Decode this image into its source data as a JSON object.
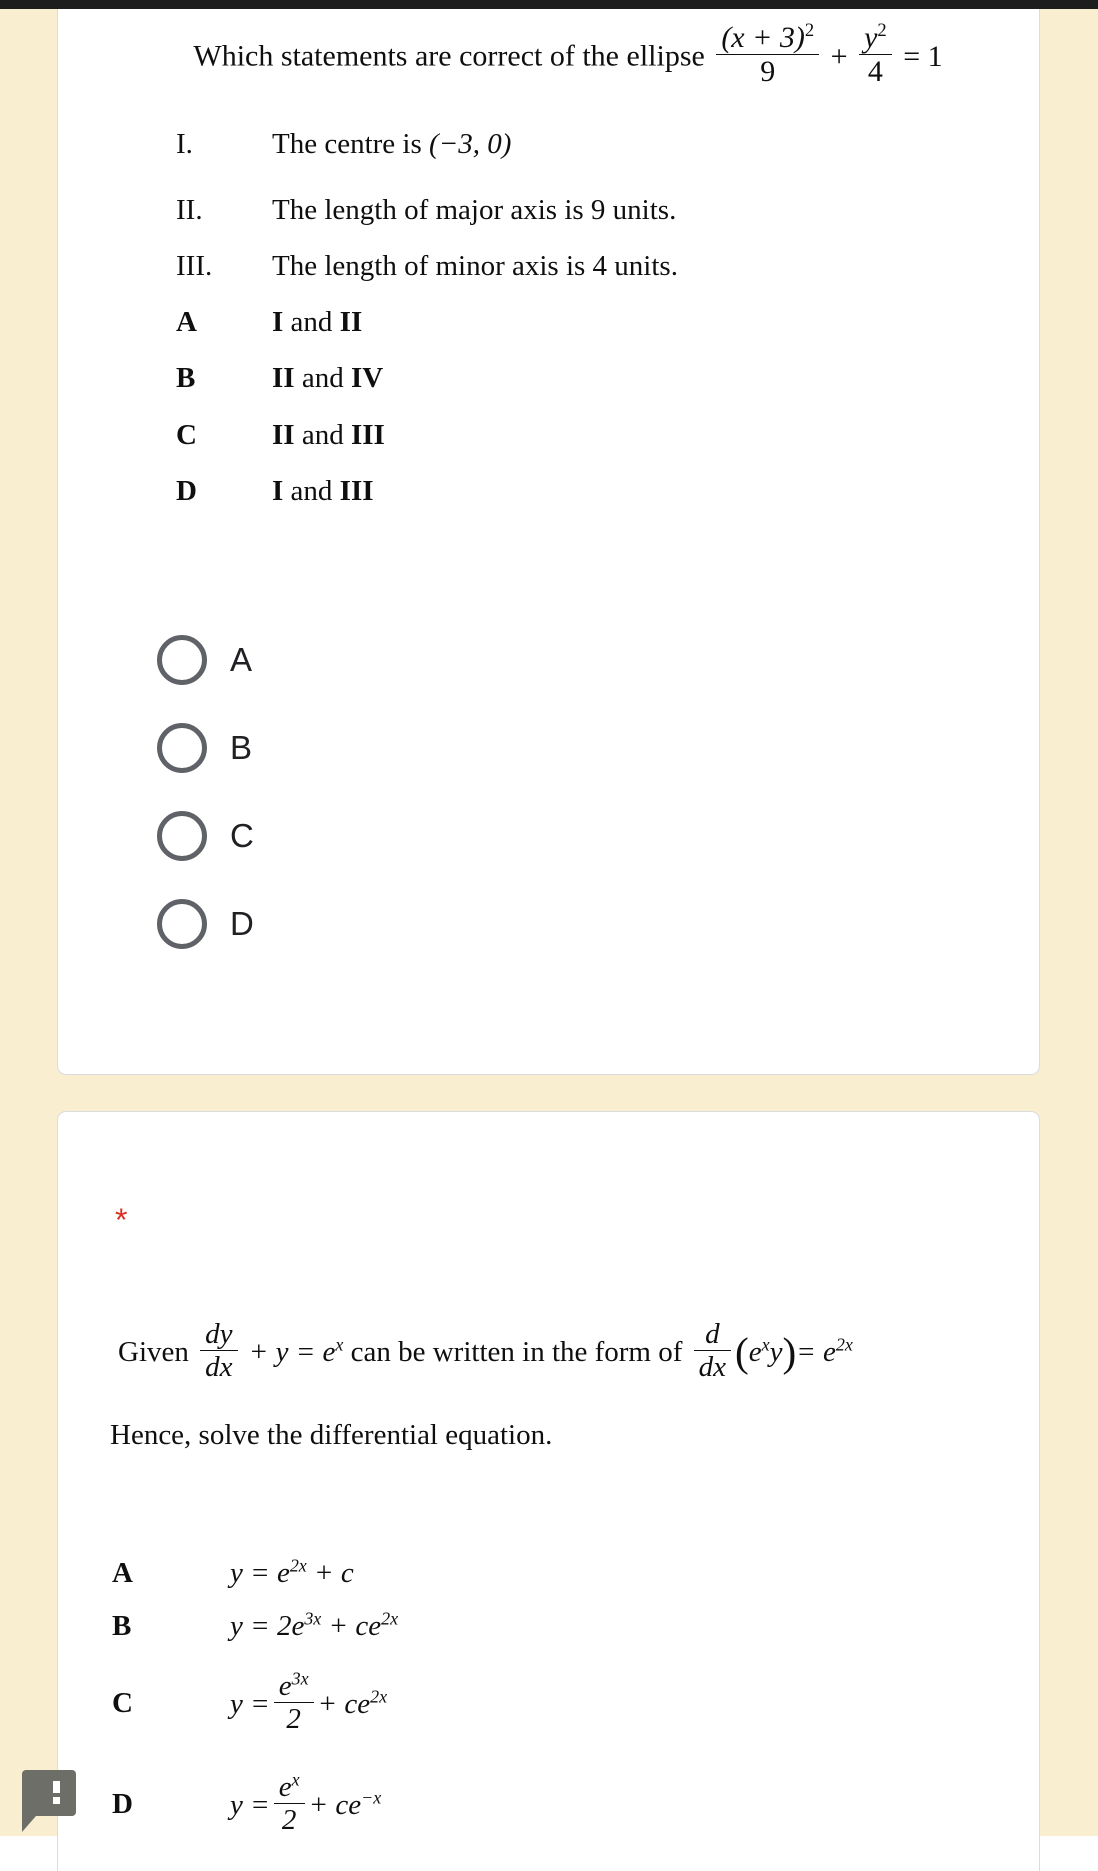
{
  "theme": {
    "page_background": "#faeed0",
    "card_background": "#ffffff",
    "card_border": "#dadce0",
    "top_bar": "#1d1d1d",
    "required_star_color": "#d93025",
    "radio_border_color": "#5f6368",
    "feedback_icon_color": "#6e6e68"
  },
  "question1": {
    "stem_prefix": "Which statements are correct of the ellipse",
    "equation": {
      "term1_numerator": "(x + 3)",
      "term1_numerator_exponent": "2",
      "term1_denominator": "9",
      "plus": "+",
      "term2_numerator": "y",
      "term2_numerator_exponent": "2",
      "term2_denominator": "4",
      "equals": "= 1"
    },
    "statements": [
      {
        "label": "I.",
        "text": "The centre is",
        "math": "(−3, 0)"
      },
      {
        "label": "II.",
        "text": "The length of major axis is 9 units."
      },
      {
        "label": "III.",
        "text": "The length of minor axis is 4 units."
      }
    ],
    "choices": [
      {
        "label": "A",
        "part1": "I",
        "conj": " and ",
        "part2": "II"
      },
      {
        "label": "B",
        "part1": "II",
        "conj": " and ",
        "part2": "IV"
      },
      {
        "label": "C",
        "part1": "II",
        "conj": " and ",
        "part2": "III"
      },
      {
        "label": "D",
        "part1": "I",
        "conj": " and ",
        "part2": "III"
      }
    ],
    "radio_options": [
      {
        "value": "A",
        "selected": false
      },
      {
        "value": "B",
        "selected": false
      },
      {
        "value": "C",
        "selected": false
      },
      {
        "value": "D",
        "selected": false
      }
    ]
  },
  "question2": {
    "required_marker": "*",
    "stem_part1": "Given",
    "stem_lhs_num": "dy",
    "stem_lhs_den": "dx",
    "stem_lhs_rest": "+ y = e",
    "stem_lhs_rest_exp": "x",
    "stem_part2": "can be written in the form of",
    "stem_rhs_num": "d",
    "stem_rhs_den": "dx",
    "stem_rhs_open": "(",
    "stem_rhs_e": "e",
    "stem_rhs_e_exp": "x",
    "stem_rhs_y": "y",
    "stem_rhs_close": ")",
    "stem_rhs_eq": "= e",
    "stem_rhs_eq_exp": "2x",
    "instruction": "Hence, solve the differential equation.",
    "choices": [
      {
        "label": "A",
        "type": "plain",
        "lhs": "y = e",
        "lhs_exp": "2x",
        "tail": "+ c"
      },
      {
        "label": "B",
        "type": "plain",
        "lhs": "y = 2e",
        "lhs_exp": "3x",
        "tail": "+ ce",
        "tail_exp": "2x"
      },
      {
        "label": "C",
        "type": "fraction",
        "lhs": "y =",
        "num": "e",
        "num_exp": "3x",
        "den": "2",
        "tail": "+ ce",
        "tail_exp": "2x"
      },
      {
        "label": "D",
        "type": "fraction",
        "lhs": "y =",
        "num": "e",
        "num_exp": "x",
        "den": "2",
        "tail": "+ ce",
        "tail_exp": "−x"
      }
    ]
  },
  "feedback": {
    "icon": "report-feedback-icon",
    "tooltip": "!"
  }
}
